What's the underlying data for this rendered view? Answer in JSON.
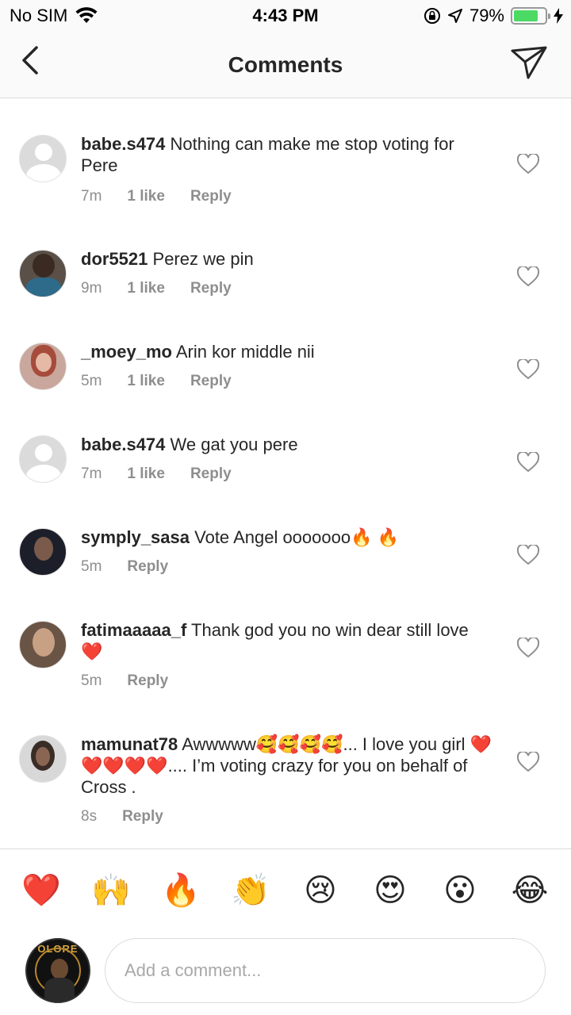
{
  "status_bar": {
    "carrier": "No SIM",
    "time": "4:43 PM",
    "battery_percent": "79%",
    "battery_level": 0.79
  },
  "header": {
    "title": "Comments"
  },
  "comments": [
    {
      "username": "babe.s474",
      "text": "Nothing can make me stop voting for Pere",
      "age": "7m",
      "likes": "1 like",
      "reply": "Reply"
    },
    {
      "username": "dor5521",
      "text": "Perez we pin",
      "age": "9m",
      "likes": "1 like",
      "reply": "Reply"
    },
    {
      "username": "_moey_mo",
      "text": "Arin kor middle nii",
      "age": "5m",
      "likes": "1 like",
      "reply": "Reply"
    },
    {
      "username": "babe.s474",
      "text": "We gat you pere",
      "age": "7m",
      "likes": "1 like",
      "reply": "Reply"
    },
    {
      "username": "symply_sasa",
      "text": "Vote Angel ooooooo🔥 🔥",
      "age": "5m",
      "likes": "",
      "reply": "Reply"
    },
    {
      "username": "fatimaaaaa_f",
      "text": "Thank god you no win dear still love ❤️",
      "age": "5m",
      "likes": "",
      "reply": "Reply"
    },
    {
      "username": "mamunat78",
      "text": "Awwwww🥰🥰🥰🥰... I love you girl ❤️❤️❤️❤️❤️.... I’m voting  crazy for you on behalf of Cross .",
      "age": "8s",
      "likes": "",
      "reply": "Reply"
    }
  ],
  "reactions": [
    "❤️",
    "🙌",
    "🔥",
    "👏",
    "😢",
    "😍",
    "😮",
    "😂"
  ],
  "composer": {
    "placeholder": "Add a comment...",
    "avatar_text": "OLORE"
  },
  "colors": {
    "muted": "#8e8e8e",
    "text": "#262626",
    "battery": "#4cd964"
  }
}
